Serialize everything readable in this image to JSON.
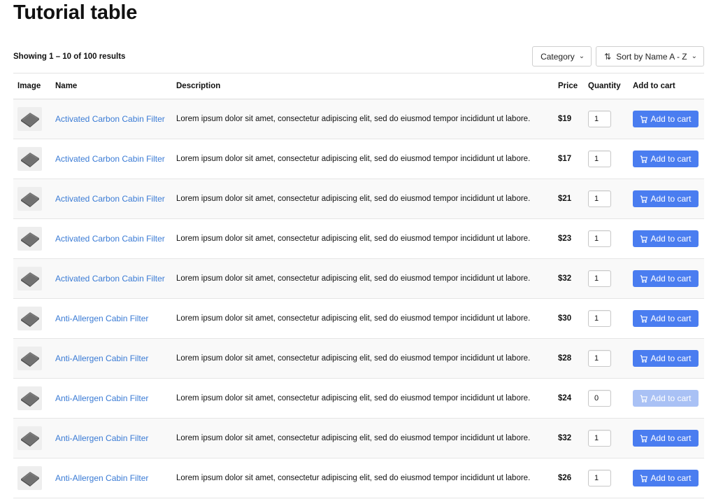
{
  "page": {
    "title": "Tutorial table",
    "results_text": "Showing 1 – 10 of 100 results"
  },
  "filters": {
    "category_label": "Category",
    "sort_label": "Sort by Name A - Z"
  },
  "table": {
    "columns": [
      "Image",
      "Name",
      "Description",
      "Price",
      "Quantity",
      "Add to cart"
    ],
    "button_label": "Add to cart",
    "rows": [
      {
        "name": "Activated Carbon Cabin Filter",
        "description": "Lorem ipsum dolor sit amet, consectetur adipiscing elit, sed do eiusmod tempor incididunt ut labore.",
        "price": "$19",
        "quantity": "1",
        "enabled": true
      },
      {
        "name": "Activated Carbon Cabin Filter",
        "description": "Lorem ipsum dolor sit amet, consectetur adipiscing elit, sed do eiusmod tempor incididunt ut labore.",
        "price": "$17",
        "quantity": "1",
        "enabled": true
      },
      {
        "name": "Activated Carbon Cabin Filter",
        "description": "Lorem ipsum dolor sit amet, consectetur adipiscing elit, sed do eiusmod tempor incididunt ut labore.",
        "price": "$21",
        "quantity": "1",
        "enabled": true
      },
      {
        "name": "Activated Carbon Cabin Filter",
        "description": "Lorem ipsum dolor sit amet, consectetur adipiscing elit, sed do eiusmod tempor incididunt ut labore.",
        "price": "$23",
        "quantity": "1",
        "enabled": true
      },
      {
        "name": "Activated Carbon Cabin Filter",
        "description": "Lorem ipsum dolor sit amet, consectetur adipiscing elit, sed do eiusmod tempor incididunt ut labore.",
        "price": "$32",
        "quantity": "1",
        "enabled": true
      },
      {
        "name": "Anti-Allergen Cabin Filter",
        "description": "Lorem ipsum dolor sit amet, consectetur adipiscing elit, sed do eiusmod tempor incididunt ut labore.",
        "price": "$30",
        "quantity": "1",
        "enabled": true
      },
      {
        "name": "Anti-Allergen Cabin Filter",
        "description": "Lorem ipsum dolor sit amet, consectetur adipiscing elit, sed do eiusmod tempor incididunt ut labore.",
        "price": "$28",
        "quantity": "1",
        "enabled": true
      },
      {
        "name": "Anti-Allergen Cabin Filter",
        "description": "Lorem ipsum dolor sit amet, consectetur adipiscing elit, sed do eiusmod tempor incididunt ut labore.",
        "price": "$24",
        "quantity": "0",
        "enabled": false
      },
      {
        "name": "Anti-Allergen Cabin Filter",
        "description": "Lorem ipsum dolor sit amet, consectetur adipiscing elit, sed do eiusmod tempor incididunt ut labore.",
        "price": "$32",
        "quantity": "1",
        "enabled": true
      },
      {
        "name": "Anti-Allergen Cabin Filter",
        "description": "Lorem ipsum dolor sit amet, consectetur adipiscing elit, sed do eiusmod tempor incididunt ut labore.",
        "price": "$26",
        "quantity": "1",
        "enabled": true
      }
    ]
  },
  "icons": {
    "product_image": "filter-product-icon",
    "cart": "cart-icon",
    "chevron": "chevron-down-icon",
    "sort": "sort-icon"
  },
  "colors": {
    "link": "#3a7bd5",
    "button": "#4a7df0",
    "button_disabled": "#a9c1f5"
  }
}
